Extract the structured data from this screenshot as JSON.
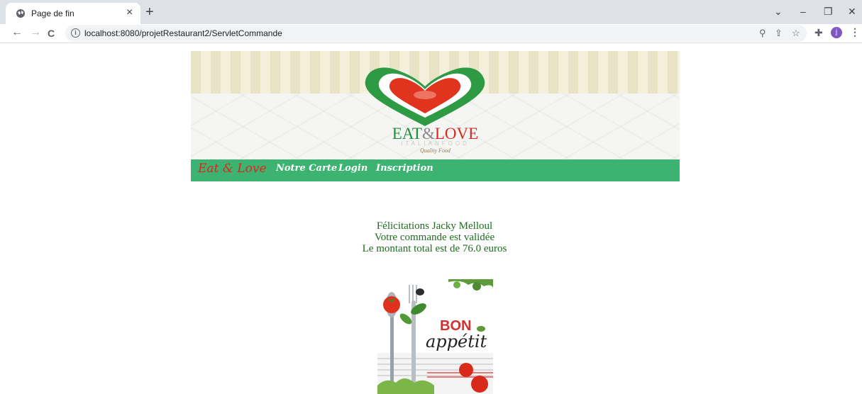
{
  "browser": {
    "tab_title": "Page de fin",
    "tab_close": "×",
    "new_tab": "+",
    "url": "localhost:8080/projetRestaurant2/ServletCommande",
    "profile_initial": "j",
    "window_controls": [
      "⌄",
      "–",
      "❐",
      "✕"
    ],
    "nav": {
      "back": "←",
      "forward": "→",
      "reload": "C"
    }
  },
  "banner": {
    "brand_eat": "EAT",
    "brand_amp": "&",
    "brand_love": "LOVE",
    "subtitle": "ITALIANFOOD",
    "tagline": "Quality Food"
  },
  "navbar": {
    "brand": "Eat & Love",
    "items": [
      {
        "label": "Notre Carte"
      },
      {
        "label": "Login"
      },
      {
        "label": "Inscription"
      }
    ]
  },
  "message": {
    "line1": "Félicitations Jacky Melloul",
    "line2": "Votre commande est validée",
    "line3": "Le montant total est de 76.0 euros"
  },
  "poster": {
    "word1": "BON",
    "word2": "appétit"
  },
  "colors": {
    "navbar": "#3cb371",
    "brand_red": "#e8201c",
    "message_text": "#1f6b1f"
  }
}
